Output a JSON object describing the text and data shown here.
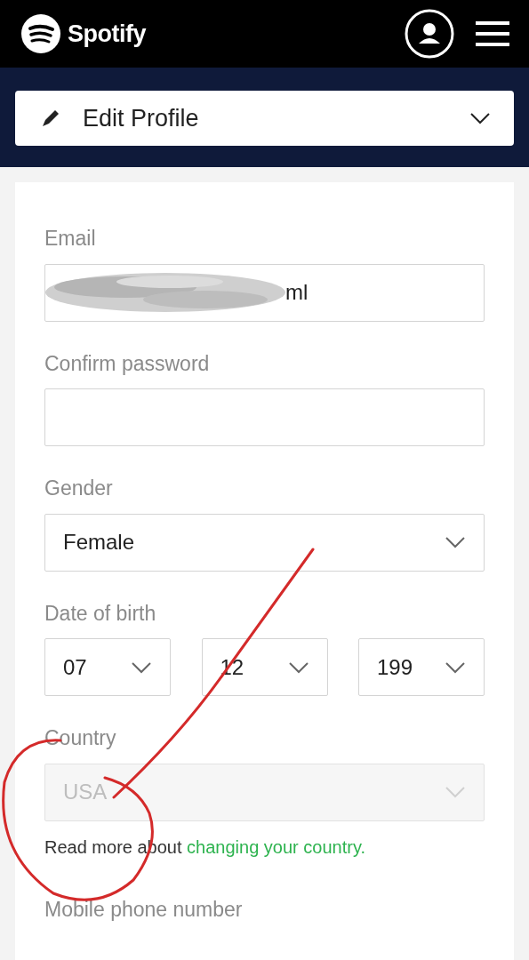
{
  "header": {
    "logo": "Spotify"
  },
  "menu": {
    "label": "Edit Profile",
    "expanded": false
  },
  "form": {
    "fields": [
      {
        "kind": "text",
        "label": "Email",
        "value": "ml",
        "redacted": true
      },
      {
        "kind": "password",
        "label": "Confirm password"
      },
      {
        "kind": "select",
        "label": "Gender",
        "value": "Female",
        "disabled": false
      },
      {
        "kind": "date",
        "label": "Date of birth",
        "parts": [
          "07",
          "12",
          "199"
        ]
      },
      {
        "kind": "select",
        "label": "Country",
        "value": "USA",
        "disabled": true
      }
    ],
    "note": {
      "text": "Read more about ",
      "link": "changing your country."
    },
    "next_label": "Mobile phone number"
  }
}
